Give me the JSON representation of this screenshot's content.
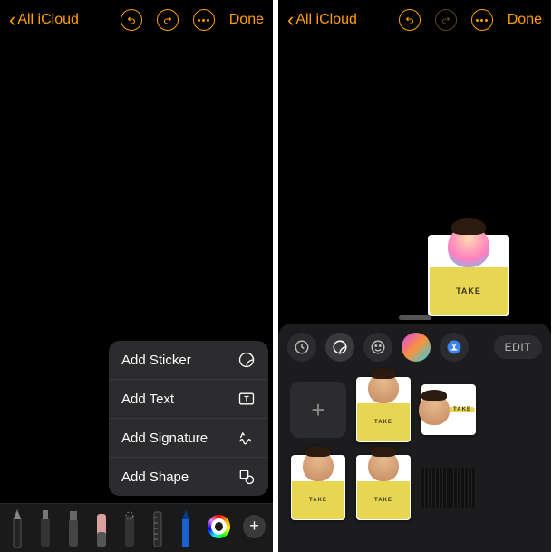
{
  "nav": {
    "back_label": "All iCloud",
    "done_label": "Done"
  },
  "add_menu": {
    "items": [
      {
        "label": "Add Sticker",
        "icon": "sticker-icon"
      },
      {
        "label": "Add Text",
        "icon": "text-box-icon"
      },
      {
        "label": "Add Signature",
        "icon": "signature-icon"
      },
      {
        "label": "Add Shape",
        "icon": "shapes-icon"
      }
    ]
  },
  "markup_tools": [
    "pen",
    "marker",
    "highlighter",
    "eraser",
    "lasso",
    "ruler",
    "pencil"
  ],
  "sticker_panel": {
    "tabs": [
      {
        "name": "recents",
        "icon": "clock-icon"
      },
      {
        "name": "stickers",
        "icon": "sticker-icon"
      },
      {
        "name": "emoji",
        "icon": "emoji-icon"
      },
      {
        "name": "memoji",
        "icon": "memoji-icon"
      },
      {
        "name": "appstore",
        "icon": "appstore-icon"
      }
    ],
    "active_tab": "stickers",
    "edit_label": "EDIT"
  },
  "placed_sticker": {
    "tee_text": "TAKE",
    "style": "comic"
  },
  "grid_stickers": [
    {
      "kind": "add"
    },
    {
      "kind": "person",
      "tee": "yellow",
      "tee_text": "TAKE"
    },
    {
      "kind": "person-side",
      "tee": "yellow",
      "tee_text": "TAKE"
    },
    {
      "kind": "person",
      "tee": "yellow",
      "tee_text": "TAKE"
    },
    {
      "kind": "person",
      "tee": "yellow",
      "tee_text": "TAKE"
    },
    {
      "kind": "keyboard"
    }
  ]
}
